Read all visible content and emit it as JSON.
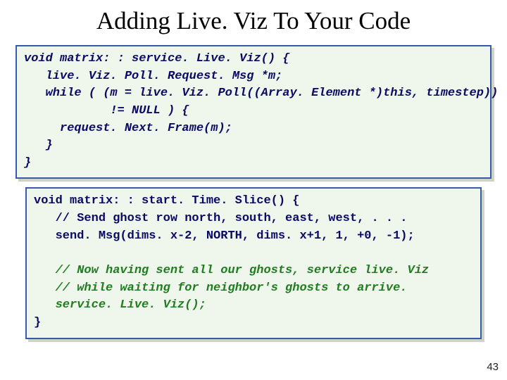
{
  "title": "Adding Live. Viz To Your Code",
  "box1": {
    "l1": "void matrix: : service. Live. Viz() {",
    "l2": "   live. Viz. Poll. Request. Msg *m;",
    "l3": "   while ( (m = live. Viz. Poll((Array. Element *)this, timestep))",
    "l4": "            != NULL ) {",
    "l5": "     request. Next. Frame(m);",
    "l6": "   }",
    "l7": "}"
  },
  "box2": {
    "l1": "void matrix: : start. Time. Slice() {",
    "l2": "   // Send ghost row north, south, east, west, . . .",
    "l3": "   send. Msg(dims. x-2, NORTH, dims. x+1, 1, +0, -1);",
    "l4": "   // Now having sent all our ghosts, service live. Viz",
    "l5": "   // while waiting for neighbor's ghosts to arrive.",
    "l6": "   service. Live. Viz();",
    "l7": "}"
  },
  "page_number": "43"
}
